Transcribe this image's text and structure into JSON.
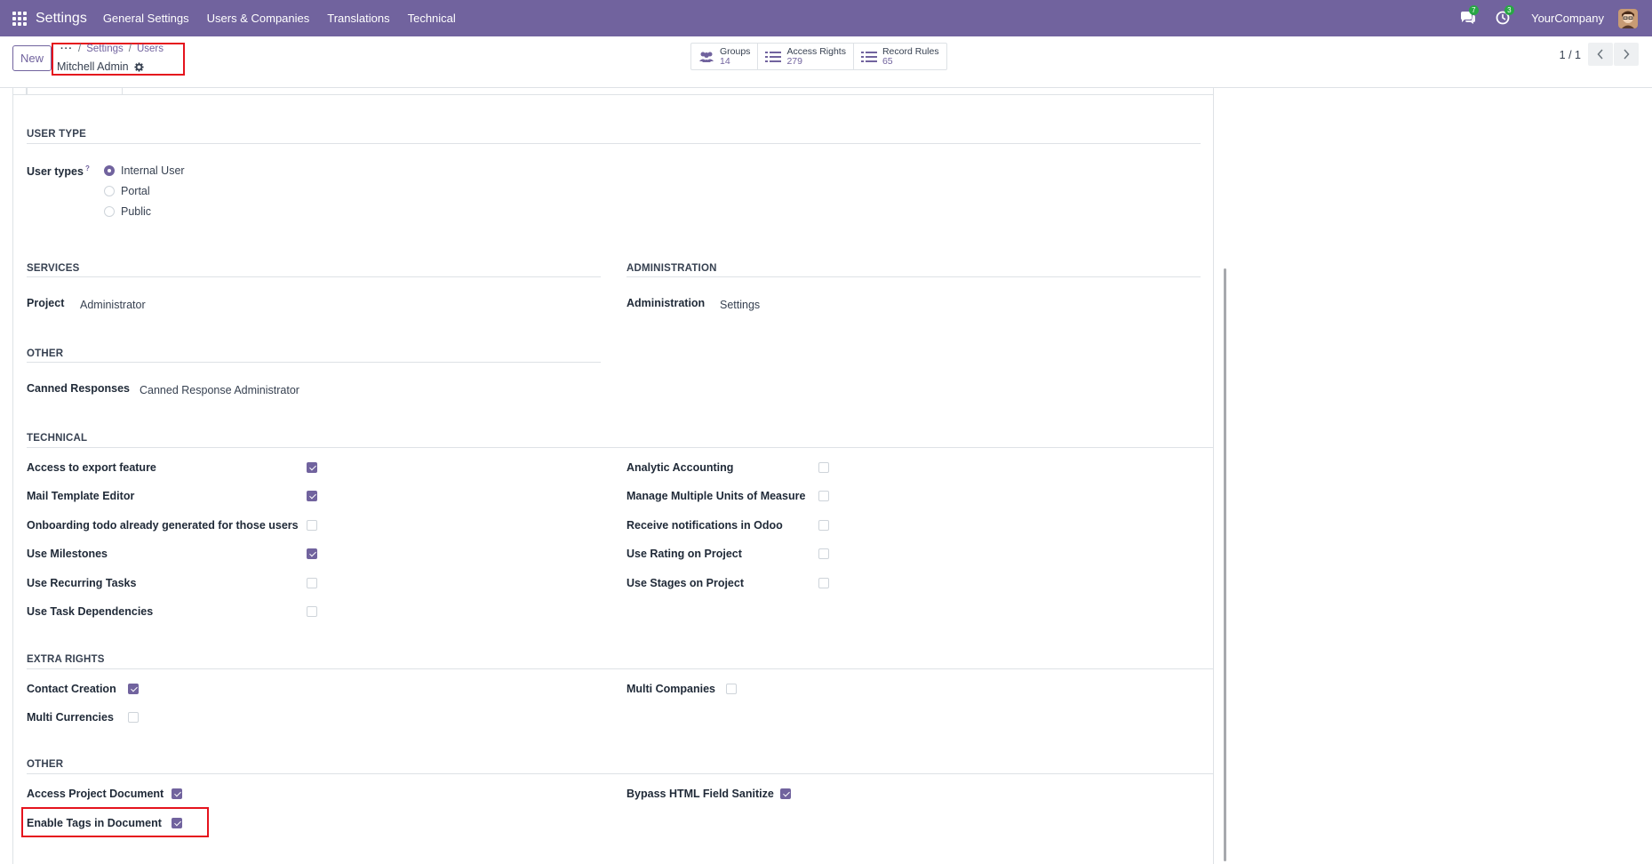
{
  "navbar": {
    "app_name": "Settings",
    "menus": [
      "General Settings",
      "Users & Companies",
      "Translations",
      "Technical"
    ],
    "messages_count": "7",
    "activities_count": "3",
    "company": "YourCompany"
  },
  "control": {
    "new_label": "New",
    "breadcrumb": {
      "dots": "···",
      "sep": "/",
      "settings": "Settings",
      "users": "Users"
    },
    "record_name": "Mitchell Admin",
    "smart_buttons": [
      {
        "label": "Groups",
        "value": "14",
        "icon": "users-icon"
      },
      {
        "label": "Access Rights",
        "value": "279",
        "icon": "list-icon"
      },
      {
        "label": "Record Rules",
        "value": "65",
        "icon": "list-icon"
      }
    ],
    "pager": "1 / 1"
  },
  "user_type": {
    "title": "USER TYPE",
    "label": "User types",
    "help": "?",
    "options": [
      "Internal User",
      "Portal",
      "Public"
    ],
    "selected": "Internal User"
  },
  "services": {
    "title": "SERVICES",
    "project_label": "Project",
    "project_value": "Administrator"
  },
  "administration": {
    "title": "ADMINISTRATION",
    "label": "Administration",
    "value": "Settings"
  },
  "other1": {
    "title": "OTHER",
    "canned_label": "Canned Responses",
    "canned_value": "Canned Response Administrator"
  },
  "technical": {
    "title": "TECHNICAL",
    "left": [
      {
        "label": "Access to export feature",
        "checked": true
      },
      {
        "label": "Mail Template Editor",
        "checked": true
      },
      {
        "label": "Onboarding todo already generated for those users",
        "checked": false
      },
      {
        "label": "Use Milestones",
        "checked": true
      },
      {
        "label": "Use Recurring Tasks",
        "checked": false
      },
      {
        "label": "Use Task Dependencies",
        "checked": false
      }
    ],
    "right": [
      {
        "label": "Analytic Accounting",
        "checked": false
      },
      {
        "label": "Manage Multiple Units of Measure",
        "checked": false
      },
      {
        "label": "Receive notifications in Odoo",
        "checked": false
      },
      {
        "label": "Use Rating on Project",
        "checked": false
      },
      {
        "label": "Use Stages on Project",
        "checked": false
      }
    ]
  },
  "extra_rights": {
    "title": "EXTRA RIGHTS",
    "contact_creation": {
      "label": "Contact Creation",
      "checked": true
    },
    "multi_currencies": {
      "label": "Multi Currencies",
      "checked": false
    },
    "multi_companies": {
      "label": "Multi Companies",
      "checked": false
    }
  },
  "other2": {
    "title": "OTHER",
    "access_project_document": {
      "label": "Access Project Document",
      "checked": true
    },
    "enable_tags": {
      "label": "Enable Tags in Document",
      "checked": true
    },
    "bypass_html": {
      "label": "Bypass HTML Field Sanitize",
      "checked": true
    }
  },
  "colors": {
    "navbar": "#71639e",
    "accent": "#71639e",
    "highlight": "#e5131d"
  }
}
